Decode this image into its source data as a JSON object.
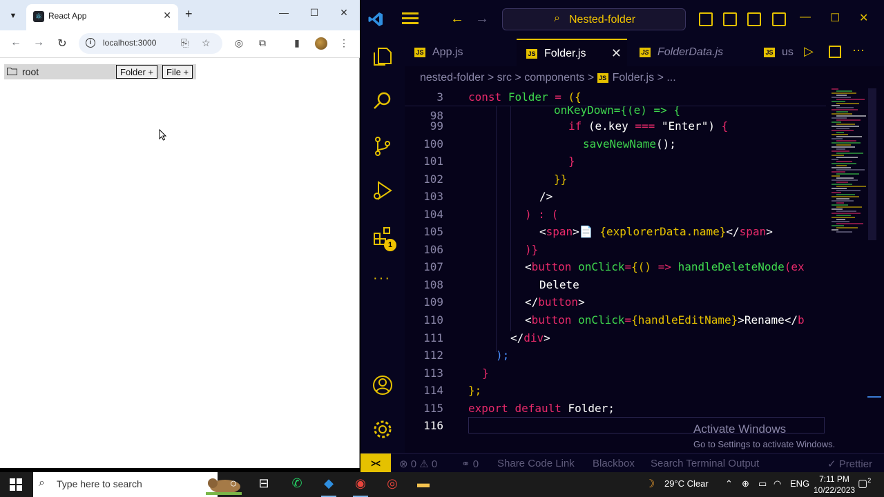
{
  "chrome": {
    "tab_title": "React App",
    "url": "localhost:3000",
    "page": {
      "root_label": "root",
      "folder_button": "Folder +",
      "file_button": "File +"
    }
  },
  "vscode": {
    "command_center": "Nested-folder",
    "tabs": [
      {
        "label": "App.js",
        "active": false
      },
      {
        "label": "Folder.js",
        "active": true
      },
      {
        "label": "FolderData.js",
        "active": false
      },
      {
        "label": "us",
        "active": false
      }
    ],
    "breadcrumb": {
      "p1": "nested-folder",
      "sep": ">",
      "p2": "src",
      "p3": "components",
      "js_badge": "JS",
      "p4": "Folder.js",
      "p5": "..."
    },
    "sticky": {
      "line": "3",
      "code": "const Folder = ({"
    },
    "line_numbers": [
      "98",
      "99",
      "100",
      "101",
      "102",
      "103",
      "104",
      "105",
      "106",
      "107",
      "108",
      "109",
      "110",
      "111",
      "112",
      "113",
      "114",
      "115",
      "116"
    ],
    "code_lines": {
      "l98": "onKeyDown={(e) => {",
      "l99a": "if",
      "l99b": "(e.key",
      "l99c": "===",
      "l99d": "\"Enter\")",
      "l99e": "{",
      "l100a": "saveNewName",
      "l100b": "();",
      "l101": "}",
      "l102": "}}",
      "l103": "/>",
      "l104a": ")",
      "l104b": ":",
      "l104c": "(",
      "l105a": "<",
      "l105b": "span",
      "l105c": ">",
      "l105d": "📄",
      "l105e": "{explorerData.name}",
      "l105f": "</",
      "l105g": "span",
      "l105h": ">",
      "l106": ")}",
      "l107a": "<",
      "l107b": "button",
      "l107c": "onClick",
      "l107d": "=",
      "l107e": "{()",
      "l107f": "=>",
      "l107g": "handleDeleteNode",
      "l107h": "(ex",
      "l108": "Delete",
      "l109a": "</",
      "l109b": "button",
      "l109c": ">",
      "l110a": "<",
      "l110b": "button",
      "l110c": "onClick",
      "l110d": "=",
      "l110e": "{handleEditName}",
      "l110f": ">Rename</",
      "l110g": "b",
      "l111a": "</",
      "l111b": "div",
      "l111c": ">",
      "l112": ");",
      "l113": "}",
      "l114": "};",
      "l115a": "export",
      "l115b": "default",
      "l115c": "Folder;"
    },
    "watermark": {
      "title": "Activate Windows",
      "subtitle": "Go to Settings to activate Windows."
    },
    "status": {
      "errors": "0",
      "warnings": "0",
      "ports": "0",
      "share": "Share Code Link",
      "blackbox": "Blackbox",
      "search": "Search Terminal Output",
      "prettier": "Prettier"
    },
    "extensions_badge": "1"
  },
  "taskbar": {
    "search_placeholder": "Type here to search",
    "weather": "29°C  Clear",
    "lang": "ENG",
    "time": "7:11 PM",
    "date": "10/22/2023",
    "notifications": "2"
  },
  "colors": {
    "vscode_bg": "#06031a",
    "accent_yellow": "#e5c100",
    "keyword_pink": "#e82a6a",
    "func_green": "#3fd94e"
  }
}
